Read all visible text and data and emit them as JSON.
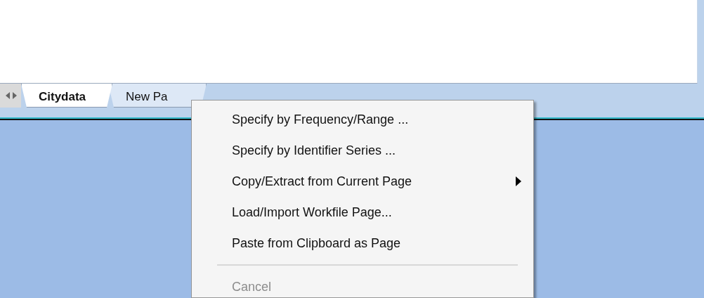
{
  "tabs": [
    {
      "label": "Citydata",
      "selected": true
    },
    {
      "label": "New Pa",
      "selected": false
    }
  ],
  "context_menu": {
    "items": [
      {
        "kind": "item",
        "label": "Specify by Frequency/Range ...",
        "disabled": false
      },
      {
        "kind": "item",
        "label": "Specify by Identifier Series ...",
        "disabled": false
      },
      {
        "kind": "submenu",
        "label": "Copy/Extract from Current Page",
        "disabled": false
      },
      {
        "kind": "item",
        "label": "Load/Import Workfile Page...",
        "disabled": false
      },
      {
        "kind": "item",
        "label": "Paste from Clipboard as Page",
        "disabled": false
      },
      {
        "kind": "separator"
      },
      {
        "kind": "item",
        "label": "Cancel",
        "disabled": true
      }
    ]
  }
}
